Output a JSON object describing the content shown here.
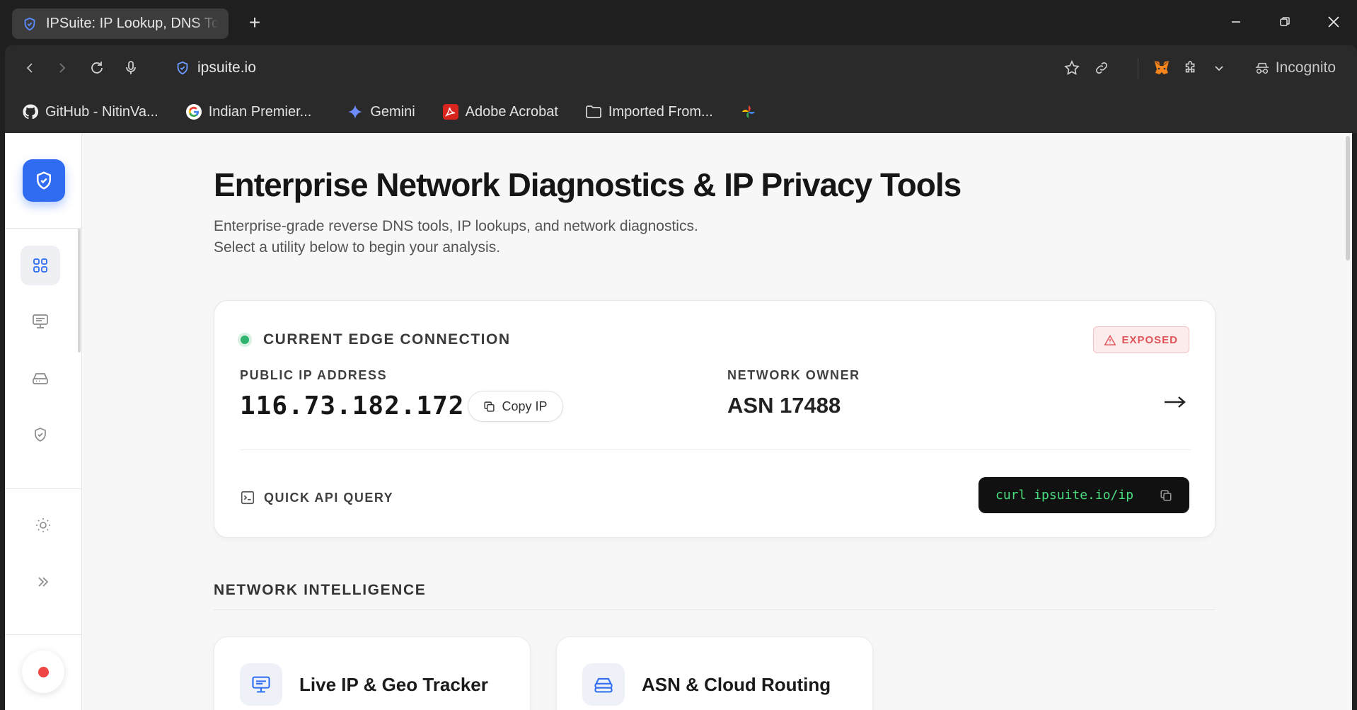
{
  "browser": {
    "tab_title": "IPSuite: IP Lookup, DNS Tools",
    "url": "ipsuite.io",
    "incognito_label": "Incognito",
    "bookmarks": [
      {
        "label": "GitHub - NitinVa...",
        "icon": "github-icon"
      },
      {
        "label": "Indian Premier...",
        "icon": "google-icon"
      },
      {
        "label": "Gemini",
        "icon": "gemini-icon"
      },
      {
        "label": "Adobe Acrobat",
        "icon": "acrobat-icon"
      },
      {
        "label": "Imported From...",
        "icon": "folder-icon"
      }
    ]
  },
  "header": {
    "title": "Enterprise Network Diagnostics & IP Privacy Tools",
    "subtitle_line1": "Enterprise-grade reverse DNS tools, IP lookups, and network diagnostics.",
    "subtitle_line2": "Select a utility below to begin your analysis."
  },
  "connection": {
    "title": "CURRENT EDGE CONNECTION",
    "status_badge": "EXPOSED",
    "ip_label": "PUBLIC IP ADDRESS",
    "ip_value": "116.73.182.172",
    "copy_label": "Copy IP",
    "owner_label": "NETWORK OWNER",
    "owner_value": "ASN 17488",
    "quick_api_label": "QUICK API QUERY",
    "curl_command": "curl ipsuite.io/ip",
    "colors": {
      "live": "#2fb36f",
      "exposed": "#e0545a",
      "curl_text": "#4ade80"
    }
  },
  "section": {
    "title": "NETWORK INTELLIGENCE",
    "tools": [
      {
        "label": "Live IP & Geo Tracker",
        "icon": "monitor-icon"
      },
      {
        "label": "ASN & Cloud Routing",
        "icon": "server-icon"
      }
    ]
  },
  "theme": {
    "accent": "#2f6cf2"
  }
}
